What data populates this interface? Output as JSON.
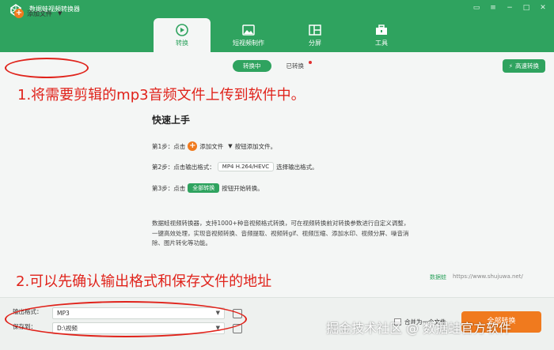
{
  "app": {
    "title": "数据蛙视频转换器"
  },
  "nav": {
    "tabs": [
      {
        "label": "转换",
        "icon": "convert-icon",
        "active": true
      },
      {
        "label": "短视频制作",
        "icon": "image-icon",
        "active": false
      },
      {
        "label": "分屏",
        "icon": "split-screen-icon",
        "active": false
      },
      {
        "label": "工具",
        "icon": "toolbox-icon",
        "active": false
      }
    ]
  },
  "toolbar": {
    "add_file": "添加文件",
    "converting": "转换中",
    "converted": "已转换",
    "high_speed": "高速转换"
  },
  "annotations": {
    "step1": "1.将需要剪辑的mp3音频文件上传到软件中。",
    "step2": "2.可以先确认输出格式和保存文件的地址"
  },
  "quick_start": {
    "title": "快速上手",
    "step1_prefix": "第1步：点击",
    "step1_button": "添加文件",
    "step1_suffix": "按钮添加文件。",
    "step2_prefix": "第2步：点击输出格式：",
    "step2_format": "MP4 H.264/HEVC",
    "step2_suffix": "选择输出格式。",
    "step3_prefix": "第3步：点击",
    "step3_button": "全部转换",
    "step3_suffix": "按钮开始转换。",
    "description": "数据蛙视频转换器，支持1000+种音视频格式转换，可在视频转换前对转换参数进行自定义调整，一键高效处理，实现音视频转换、音频提取、视频转gif、视频压缩、添加水印、视频分屏、噪音消除、图片转化等功能。"
  },
  "brand": {
    "name": "数据蛙",
    "url": "https://www.shujuwa.net/"
  },
  "bottom": {
    "output_label": "输出格式：",
    "output_value": "MP3",
    "save_label": "保存到：",
    "save_value": "D:\\视频",
    "merge_label": "合并为一个文件",
    "convert_all": "全部转换"
  },
  "watermark": "掘金技术社区 @ 数据蛙官方软件",
  "colors": {
    "brand_green": "#2fa35f",
    "accent_orange": "#f07a1e",
    "annotation_red": "#e0231b"
  }
}
